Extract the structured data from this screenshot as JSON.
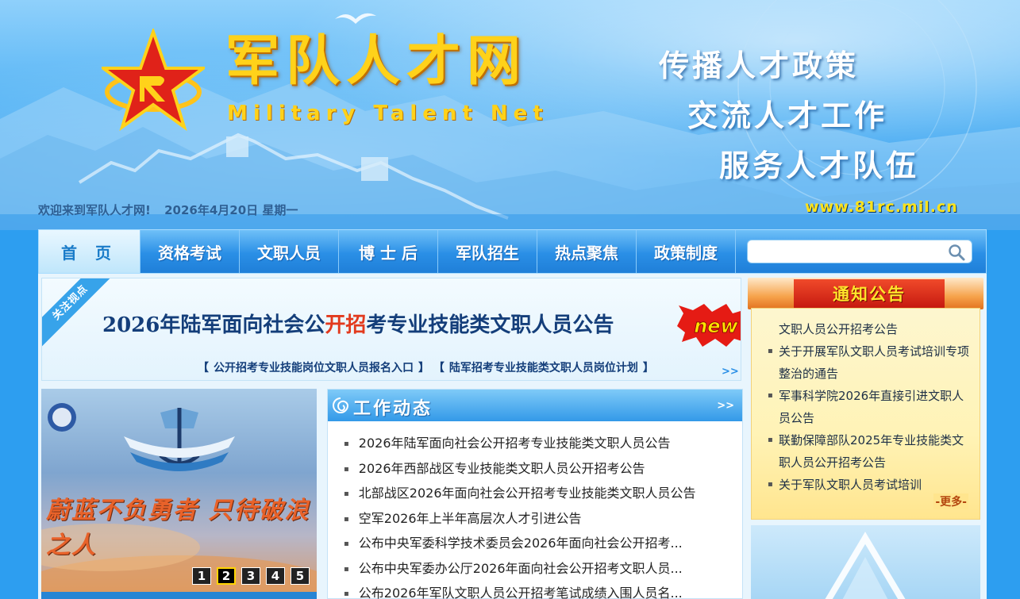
{
  "header": {
    "logo_title": "军队人才网",
    "logo_subtitle": "Military Talent Net",
    "slogans": [
      "传播人才政策",
      "交流人才工作",
      "服务人才队伍"
    ],
    "welcome": "欢迎来到军队人才网!",
    "date": "2026年4月20日 星期一",
    "url": "www.81rc.mil.cn"
  },
  "nav": {
    "items": [
      {
        "label": "首 页",
        "active": true
      },
      {
        "label": "资格考试"
      },
      {
        "label": "文职人员"
      },
      {
        "label": "博 士 后"
      },
      {
        "label": "军队招生"
      },
      {
        "label": "热点聚焦"
      },
      {
        "label": "政策制度"
      }
    ],
    "search_placeholder": ""
  },
  "headline": {
    "ribbon": "关注视点",
    "title_pre": "2026年陆军面向社会公",
    "title_hl": "开招",
    "title_post": "考专业技能类文职人员公告",
    "badge": "new",
    "link_1": "公开招考专业技能岗位文职人员报名入口",
    "link_2": "陆军招考专业技能类文职人员岗位计划",
    "more": ">>"
  },
  "slideshow": {
    "caption": "蔚蓝不负勇者 只待破浪之人",
    "dots": [
      "1",
      "2",
      "3",
      "4",
      "5"
    ],
    "active_dot": 2
  },
  "news": {
    "title": "工作动态",
    "more": ">>",
    "items": [
      "2026年陆军面向社会公开招考专业技能类文职人员公告",
      "2026年西部战区专业技能类文职人员公开招考公告",
      "北部战区2026年面向社会公开招考专业技能类文职人员公告",
      "空军2026年上半年高层次人才引进公告",
      "公布中央军委科学技术委员会2026年面向社会公开招考...",
      "公布中央军委办公厅2026年面向社会公开招考文职人员...",
      "公布2026年军队文职人员公开招考笔试成绩入围人员名..."
    ]
  },
  "notice": {
    "title": "通知公告",
    "items": [
      "文职人员公开招考公告",
      "关于开展军队文职人员考试培训专项整治的通告",
      "军事科学院2026年直接引进文职人员公告",
      "联勤保障部队2025年专业技能类文职人员公开招考公告",
      "关于军队文职人员考试培训"
    ],
    "more": "-更多-"
  },
  "colors": {
    "nav_active": "#bfe6fb",
    "headline_text": "#143e7a",
    "highlight": "#e23a1e",
    "notice_title": "#ffe52b"
  }
}
